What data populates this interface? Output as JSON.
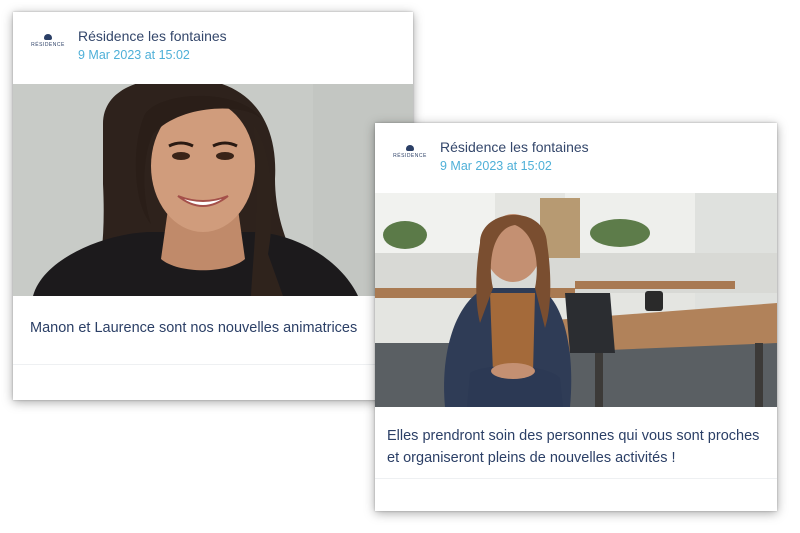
{
  "posts": [
    {
      "org_name": "Résidence les fontaines",
      "date": "9 Mar 2023 at 15:02",
      "logo_text": "RÉSIDENCE",
      "caption": "Manon et Laurence sont nos nouvelles animatrices"
    },
    {
      "org_name": "Résidence les fontaines",
      "date": "9 Mar 2023 at 15:02",
      "logo_text": "RÉSIDENCE",
      "caption": "Elles prendront soin des personnes qui vous sont proches et organiseront pleins de nouvelles activités !"
    }
  ],
  "colors": {
    "org_name": "#34476b",
    "date": "#4fb0d8",
    "caption": "#2b3f66"
  }
}
